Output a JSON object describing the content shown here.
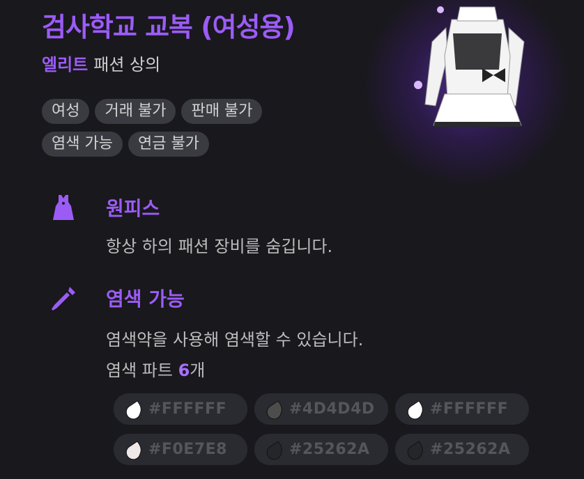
{
  "item": {
    "name": "검사학교 교복 (여성용)",
    "grade": "엘리트",
    "category": "패션 상의"
  },
  "tags": [
    [
      "여성",
      "거래 불가",
      "판매 불가"
    ],
    [
      "염색 가능",
      "연금 불가"
    ]
  ],
  "features": {
    "onepiece": {
      "title": "원피스",
      "desc": "항상 하의 패션 장비를 숨깁니다.",
      "icon": "dress-icon"
    },
    "dyeable": {
      "title": "염색 가능",
      "desc": "염색약을 사용해 염색할 수 있습니다.",
      "parts_label": "염색 파트",
      "parts_count": "6",
      "parts_unit": "개",
      "icon": "dye-dropper-icon"
    }
  },
  "dye_parts": [
    [
      {
        "hex": "#FFFFFF",
        "color": "#FFFFFF"
      },
      {
        "hex": "#4D4D4D",
        "color": "#4D4D4D"
      },
      {
        "hex": "#FFFFFF",
        "color": "#FFFFFF"
      }
    ],
    [
      {
        "hex": "#F0E7E8",
        "color": "#F0E7E8"
      },
      {
        "hex": "#25262A",
        "color": "#25262A"
      },
      {
        "hex": "#25262A",
        "color": "#25262A"
      }
    ]
  ],
  "colors": {
    "accent": "#9B5CF6",
    "background": "#19181D",
    "tag_bg": "#3A3B41",
    "dye_chip_bg": "#2A2B30"
  }
}
